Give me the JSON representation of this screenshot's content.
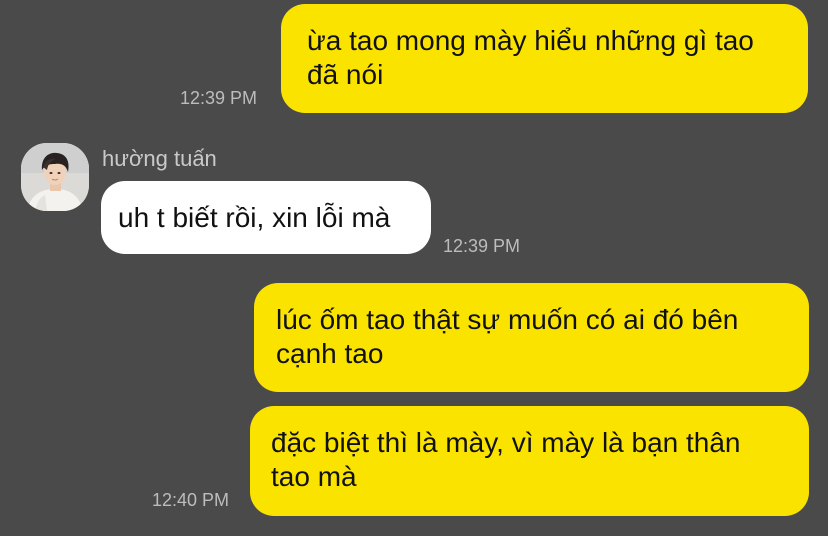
{
  "chat": {
    "messages": [
      {
        "side": "outgoing",
        "lines": [
          "ừa tao mong mày hiểu những gì tao",
          "đã nói"
        ],
        "time": "12:39 PM"
      },
      {
        "side": "incoming",
        "sender": "hường tuấn",
        "lines": [
          "uh t biết rồi, xin lỗi mà"
        ],
        "time": "12:39 PM"
      },
      {
        "side": "outgoing",
        "lines": [
          "lúc ốm tao thật sự muốn có ai đó bên",
          "cạnh tao"
        ],
        "time": ""
      },
      {
        "side": "outgoing",
        "lines": [
          "đặc biệt thì là mày, vì mày là bạn thân",
          "tao mà"
        ],
        "time": "12:40 PM"
      }
    ]
  },
  "colors": {
    "background": "#4a4a4a",
    "outgoing_bubble": "#fbe300",
    "incoming_bubble": "#ffffff"
  },
  "icons": {
    "avatar": "profile-photo"
  }
}
